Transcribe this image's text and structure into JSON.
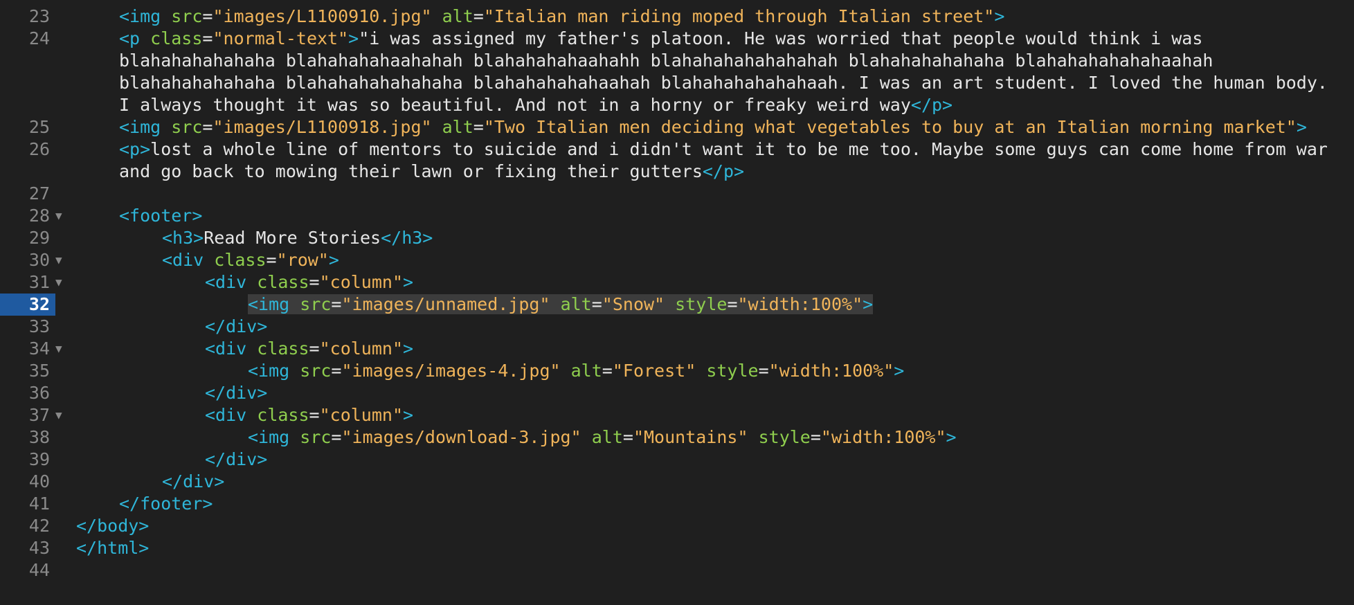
{
  "lines": [
    {
      "n": "23",
      "fold": false,
      "indent": 2,
      "segments": [
        {
          "c": "tag",
          "t": "<img "
        },
        {
          "c": "attr",
          "t": "src"
        },
        {
          "c": "txt",
          "t": "="
        },
        {
          "c": "str",
          "t": "\"images/L1100910.jpg\""
        },
        {
          "c": "txt",
          "t": " "
        },
        {
          "c": "attr",
          "t": "alt"
        },
        {
          "c": "txt",
          "t": "="
        },
        {
          "c": "str",
          "t": "\"Italian man riding moped through Italian street\""
        },
        {
          "c": "tag",
          "t": ">"
        }
      ]
    },
    {
      "n": "24",
      "fold": false,
      "indent": 2,
      "segments": [
        {
          "c": "tag",
          "t": "<p "
        },
        {
          "c": "attr",
          "t": "class"
        },
        {
          "c": "txt",
          "t": "="
        },
        {
          "c": "str",
          "t": "\"normal-text\""
        },
        {
          "c": "tag",
          "t": ">"
        },
        {
          "c": "txt",
          "t": "\"i was assigned my father's platoon. He was worried that people would think i was blahahahahahaha blahahahahaahahah blahahahahaahahh blahahahahahahahah blahahahahahaha blahahahahahahaahah blahahahahahaha blahahahahahahaha blahahahahahaahah blahahahahahahaah. I was an art student. I loved the human body. I always thought it was so beautiful. And not in a horny or freaky weird way"
        },
        {
          "c": "tag",
          "t": "</p>"
        }
      ]
    },
    {
      "n": "25",
      "fold": false,
      "indent": 2,
      "segments": [
        {
          "c": "tag",
          "t": "<img "
        },
        {
          "c": "attr",
          "t": "src"
        },
        {
          "c": "txt",
          "t": "="
        },
        {
          "c": "str",
          "t": "\"images/L1100918.jpg\""
        },
        {
          "c": "txt",
          "t": " "
        },
        {
          "c": "attr",
          "t": "alt"
        },
        {
          "c": "txt",
          "t": "="
        },
        {
          "c": "str",
          "t": "\"Two Italian men deciding what vegetables to buy at an Italian morning market\""
        },
        {
          "c": "tag",
          "t": ">"
        }
      ]
    },
    {
      "n": "26",
      "fold": false,
      "indent": 2,
      "segments": [
        {
          "c": "tag",
          "t": "<p>"
        },
        {
          "c": "txt",
          "t": "lost a whole line of mentors to suicide and i didn't want it to be me too. Maybe some guys can come home from war and go back to mowing their lawn or fixing their gutters"
        },
        {
          "c": "tag",
          "t": "</p>"
        }
      ]
    },
    {
      "n": "27",
      "fold": false,
      "indent": 0,
      "segments": []
    },
    {
      "n": "28",
      "fold": true,
      "indent": 2,
      "segments": [
        {
          "c": "tag",
          "t": "<footer>"
        }
      ]
    },
    {
      "n": "29",
      "fold": false,
      "indent": 3,
      "segments": [
        {
          "c": "tag",
          "t": "<h3>"
        },
        {
          "c": "txt",
          "t": "Read More Stories"
        },
        {
          "c": "tag",
          "t": "</h3>"
        }
      ]
    },
    {
      "n": "30",
      "fold": true,
      "indent": 3,
      "segments": [
        {
          "c": "tag",
          "t": "<div "
        },
        {
          "c": "attr",
          "t": "class"
        },
        {
          "c": "txt",
          "t": "="
        },
        {
          "c": "str",
          "t": "\"row\""
        },
        {
          "c": "tag",
          "t": ">"
        }
      ]
    },
    {
      "n": "31",
      "fold": true,
      "indent": 4,
      "segments": [
        {
          "c": "tag",
          "t": "<div "
        },
        {
          "c": "attr",
          "t": "class"
        },
        {
          "c": "txt",
          "t": "="
        },
        {
          "c": "str",
          "t": "\"column\""
        },
        {
          "c": "tag",
          "t": ">"
        }
      ]
    },
    {
      "n": "32",
      "fold": false,
      "indent": 5,
      "current": true,
      "selected": true,
      "segments": [
        {
          "c": "tag",
          "t": "<img "
        },
        {
          "c": "attr",
          "t": "src"
        },
        {
          "c": "txt",
          "t": "="
        },
        {
          "c": "str",
          "t": "\"images/unnamed.jpg\""
        },
        {
          "c": "txt",
          "t": " "
        },
        {
          "c": "attr",
          "t": "alt"
        },
        {
          "c": "txt",
          "t": "="
        },
        {
          "c": "str",
          "t": "\"Snow\""
        },
        {
          "c": "txt",
          "t": " "
        },
        {
          "c": "attr",
          "t": "style"
        },
        {
          "c": "txt",
          "t": "="
        },
        {
          "c": "str",
          "t": "\"width:100%\""
        },
        {
          "c": "tag",
          "t": ">"
        }
      ]
    },
    {
      "n": "33",
      "fold": false,
      "indent": 4,
      "segments": [
        {
          "c": "tag",
          "t": "</div>"
        }
      ]
    },
    {
      "n": "34",
      "fold": true,
      "indent": 4,
      "segments": [
        {
          "c": "tag",
          "t": "<div "
        },
        {
          "c": "attr",
          "t": "class"
        },
        {
          "c": "txt",
          "t": "="
        },
        {
          "c": "str",
          "t": "\"column\""
        },
        {
          "c": "tag",
          "t": ">"
        }
      ]
    },
    {
      "n": "35",
      "fold": false,
      "indent": 5,
      "segments": [
        {
          "c": "tag",
          "t": "<img "
        },
        {
          "c": "attr",
          "t": "src"
        },
        {
          "c": "txt",
          "t": "="
        },
        {
          "c": "str",
          "t": "\"images/images-4.jpg\""
        },
        {
          "c": "txt",
          "t": " "
        },
        {
          "c": "attr",
          "t": "alt"
        },
        {
          "c": "txt",
          "t": "="
        },
        {
          "c": "str",
          "t": "\"Forest\""
        },
        {
          "c": "txt",
          "t": " "
        },
        {
          "c": "attr",
          "t": "style"
        },
        {
          "c": "txt",
          "t": "="
        },
        {
          "c": "str",
          "t": "\"width:100%\""
        },
        {
          "c": "tag",
          "t": ">"
        }
      ]
    },
    {
      "n": "36",
      "fold": false,
      "indent": 4,
      "segments": [
        {
          "c": "tag",
          "t": "</div>"
        }
      ]
    },
    {
      "n": "37",
      "fold": true,
      "indent": 4,
      "segments": [
        {
          "c": "tag",
          "t": "<div "
        },
        {
          "c": "attr",
          "t": "class"
        },
        {
          "c": "txt",
          "t": "="
        },
        {
          "c": "str",
          "t": "\"column\""
        },
        {
          "c": "tag",
          "t": ">"
        }
      ]
    },
    {
      "n": "38",
      "fold": false,
      "indent": 5,
      "segments": [
        {
          "c": "tag",
          "t": "<img "
        },
        {
          "c": "attr",
          "t": "src"
        },
        {
          "c": "txt",
          "t": "="
        },
        {
          "c": "str",
          "t": "\"images/download-3.jpg\""
        },
        {
          "c": "txt",
          "t": " "
        },
        {
          "c": "attr",
          "t": "alt"
        },
        {
          "c": "txt",
          "t": "="
        },
        {
          "c": "str",
          "t": "\"Mountains\""
        },
        {
          "c": "txt",
          "t": " "
        },
        {
          "c": "attr",
          "t": "style"
        },
        {
          "c": "txt",
          "t": "="
        },
        {
          "c": "str",
          "t": "\"width:100%\""
        },
        {
          "c": "tag",
          "t": ">"
        }
      ]
    },
    {
      "n": "39",
      "fold": false,
      "indent": 4,
      "segments": [
        {
          "c": "tag",
          "t": "</div>"
        }
      ]
    },
    {
      "n": "40",
      "fold": false,
      "indent": 3,
      "segments": [
        {
          "c": "tag",
          "t": "</div>"
        }
      ]
    },
    {
      "n": "41",
      "fold": false,
      "indent": 2,
      "segments": [
        {
          "c": "tag",
          "t": "</footer>"
        }
      ]
    },
    {
      "n": "42",
      "fold": false,
      "indent": 1,
      "segments": [
        {
          "c": "tag",
          "t": "</body>"
        }
      ]
    },
    {
      "n": "43",
      "fold": false,
      "indent": 1,
      "segments": [
        {
          "c": "tag",
          "t": "</html>"
        }
      ]
    },
    {
      "n": "44",
      "fold": false,
      "indent": 0,
      "segments": []
    }
  ],
  "fold_glyph": "▼",
  "colors": {
    "background": "#1f1f1f",
    "tag": "#2fb6d9",
    "attribute": "#8fce4e",
    "string": "#f0b45a",
    "text": "#e6e6e6",
    "gutter": "#8a8a8a",
    "current_line": "#1f5aa0"
  }
}
